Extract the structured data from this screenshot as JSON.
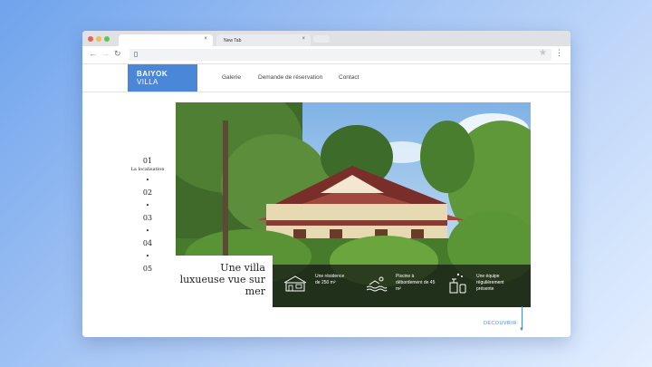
{
  "browser": {
    "tabs": [
      {
        "label": "",
        "active": true
      },
      {
        "label": "New Tab",
        "active": false
      }
    ],
    "close_glyph": "×"
  },
  "site": {
    "logo": {
      "line1": "BAIYOK",
      "line2": "VILLA"
    },
    "nav": [
      "Galerie",
      "Demande de réservation",
      "Contact"
    ]
  },
  "steps": [
    {
      "number": "01",
      "label": "La localisation"
    },
    {
      "number": "02",
      "label": ""
    },
    {
      "number": "03",
      "label": ""
    },
    {
      "number": "04",
      "label": ""
    },
    {
      "number": "05",
      "label": ""
    }
  ],
  "hero": {
    "caption": "Une villa luxueuse vue sur mer",
    "features": [
      {
        "icon": "house-icon",
        "text": "Une résidence de 250 m²"
      },
      {
        "icon": "pool-swimmer-icon",
        "text": "Piscine à débordement de 45 m²"
      },
      {
        "icon": "cleaning-icon",
        "text": "Une équipe régulièrement présente"
      }
    ]
  },
  "cta": {
    "discover": "DÉCOUVRIR"
  },
  "colors": {
    "accent": "#4a87d9",
    "background_gradient_start": "#6fa3ec"
  }
}
